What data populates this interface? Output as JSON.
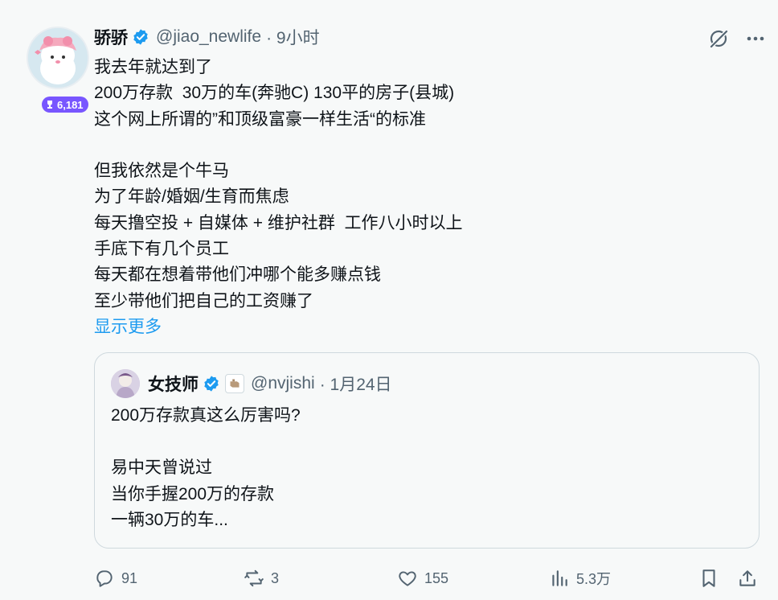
{
  "author": {
    "name": "骄骄",
    "handle": "@jiao_newlife",
    "time": "· 9小时",
    "badge_count": "6,181"
  },
  "post": {
    "lines": [
      "我去年就达到了",
      "200万存款  30万的车(奔驰C) 130平的房子(县城)",
      "这个网上所谓的”和顶级富豪一样生活“的标准",
      "",
      "但我依然是个牛马",
      "为了年龄/婚姻/生育而焦虑",
      "每天撸空投 + 自媒体 + 维护社群  工作八小时以上",
      "手底下有几个员工",
      "每天都在想着带他们冲哪个能多赚点钱",
      "至少带他们把自己的工资赚了"
    ],
    "show_more": "显示更多"
  },
  "quote": {
    "name": "女技师",
    "handle": "@nvjishi",
    "time": "· 1月24日",
    "lines": [
      "200万存款真这么厉害吗?",
      "",
      "易中天曾说过",
      "当你手握200万的存款",
      "一辆30万的车..."
    ]
  },
  "actions": {
    "replies": "91",
    "reposts": "3",
    "likes": "155",
    "views": "5.3万"
  },
  "colors": {
    "accent": "#1d9bf0",
    "muted": "#536471",
    "badge": "#7856ff"
  },
  "icons": [
    "verified-badge-icon",
    "grok-icon",
    "more-icon",
    "reply-icon",
    "repost-icon",
    "like-icon",
    "views-icon",
    "bookmark-icon",
    "share-icon"
  ]
}
